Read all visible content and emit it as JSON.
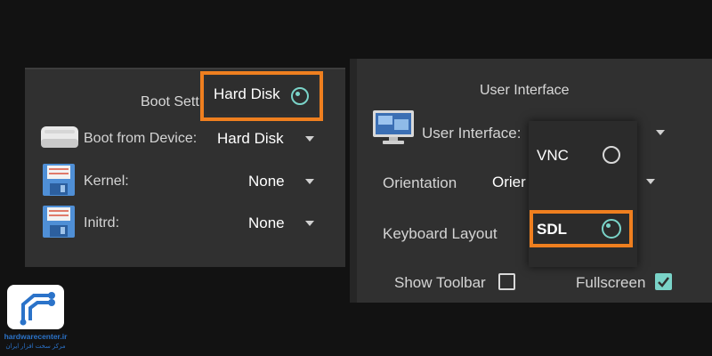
{
  "boot_settings": {
    "title": "Boot Sett",
    "rows": [
      {
        "label": "Boot from Device:",
        "value": "Hard Disk",
        "icon": "cdrom-drive-icon"
      },
      {
        "label": "Kernel:",
        "value": "None",
        "icon": "floppy-disk-icon"
      },
      {
        "label": "Initrd:",
        "value": "None",
        "icon": "floppy-disk-icon"
      }
    ],
    "popup": {
      "option_label": "Hard Disk",
      "selected": true
    }
  },
  "user_interface": {
    "title": "User Interface",
    "rows": [
      {
        "label": "User Interface:",
        "icon": "monitor-icon"
      },
      {
        "label": "Orientation",
        "value": "Orier"
      },
      {
        "label": "Keyboard Layout"
      }
    ],
    "show_toolbar": {
      "label": "Show Toolbar",
      "checked": false
    },
    "fullscreen": {
      "label": "Fullscreen",
      "checked": true
    },
    "popup": {
      "options": [
        {
          "label": "VNC",
          "selected": false
        },
        {
          "label": "SDL",
          "selected": true
        }
      ]
    }
  },
  "colors": {
    "highlight": "#ef7f1f",
    "accent": "#7ad3c8",
    "panel": "#303030",
    "background": "#121212",
    "logo": "#2b73c9"
  },
  "watermark": {
    "name": "hardwarecenter.ir",
    "subtitle": "مرکز سخت افزار ایران"
  }
}
